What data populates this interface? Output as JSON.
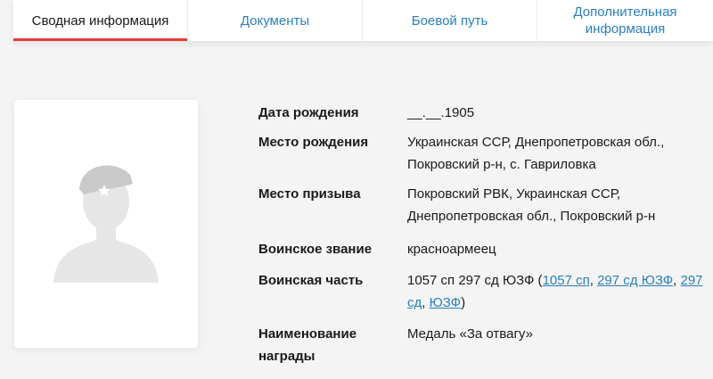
{
  "tabs": [
    {
      "label": "Сводная информация",
      "active": true
    },
    {
      "label": "Документы",
      "active": false
    },
    {
      "label": "Боевой путь",
      "active": false
    },
    {
      "label": "Дополнительная\nинформация",
      "active": false
    }
  ],
  "photo": {
    "icon": "soldier-silhouette-icon",
    "star": "star-icon"
  },
  "info": {
    "birth_date": {
      "label": "Дата рождения",
      "value": "__.__.1905"
    },
    "birth_place": {
      "label": "Место рождения",
      "value": "Украинская ССР, Днепропетровская обл., Покровский р-н, с. Гавриловка"
    },
    "conscription_place": {
      "label": "Место призыва",
      "value": "Покровский РВК, Украинская ССР, Днепропетровская обл., Покровский р-н"
    },
    "rank": {
      "label": "Воинское звание",
      "value": "красноармеец"
    },
    "unit": {
      "label": "Воинская часть",
      "value_prefix": "1057 сп 297 сд ЮЗФ (",
      "links": [
        "1057 сп",
        "297 сд ЮЗФ",
        "297 сд",
        "ЮЗФ"
      ],
      "sep": ", ",
      "value_suffix": ")"
    },
    "award": {
      "label": "Наименование\nнаграды",
      "value": "Медаль «За отвагу»"
    }
  },
  "colors": {
    "link": "#2a7fc0",
    "active_tab_underline": "#e63a3a",
    "background": "#f4f4f4"
  }
}
